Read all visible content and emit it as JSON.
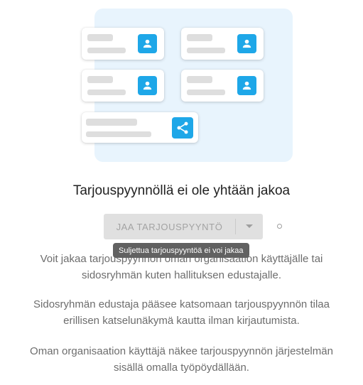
{
  "illustration": {
    "person_icon": "person-icon",
    "share_icon": "share-icon",
    "accent_color": "#1ea7e8",
    "background_color": "#e8f4fd"
  },
  "empty_state": {
    "title": "Tarjouspyynnöllä ei ole yhtään jakoa",
    "share_button_label": "JAA TARJOUSPYYNTÖ",
    "dropdown_icon": "caret-down-icon",
    "tooltip": "Suljettua tarjouspyyntöä ei voi jakaa",
    "paragraphs": [
      "Voit jakaa tarjouspyynnön oman organisaation käyttäjälle tai sidosryhmän kuten hallituksen edustajalle.",
      "Sidosryhmän edustaja pääsee katsomaan tarjouspyynnön tilaa erillisen katselunäkymä kautta ilman kirjautumista.",
      "Oman organisaation käyttäjä näkee tarjouspyynnön järjestelmän sisällä omalla työpöydällään."
    ]
  }
}
